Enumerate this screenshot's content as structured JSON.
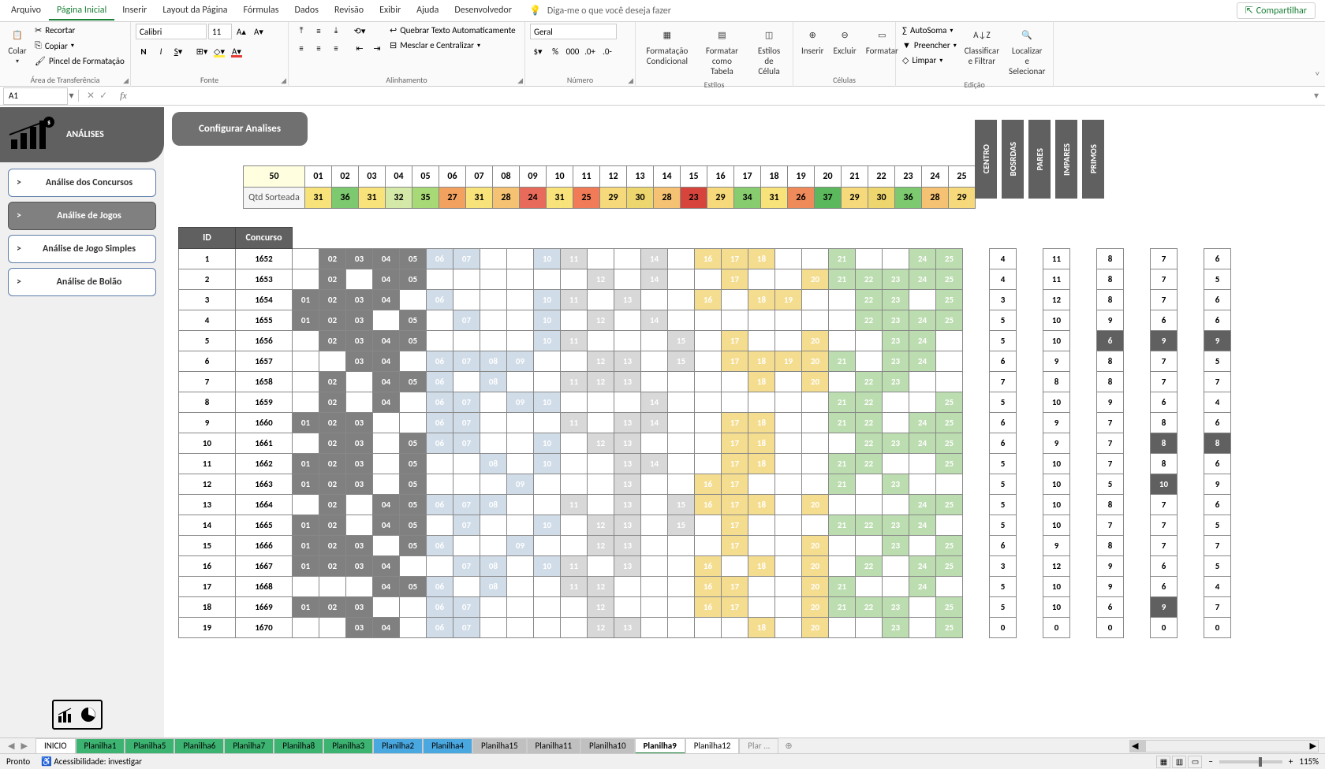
{
  "menuTabs": [
    "Arquivo",
    "Página Inicial",
    "Inserir",
    "Layout da Página",
    "Fórmulas",
    "Dados",
    "Revisão",
    "Exibir",
    "Ajuda",
    "Desenvolvedor"
  ],
  "activeTab": 1,
  "tellMe": "Diga-me o que você deseja fazer",
  "share": "Compartilhar",
  "ribbon": {
    "clipboard": {
      "paste": "Colar",
      "cut": "Recortar",
      "copy": "Copiar",
      "painter": "Pincel de Formatação",
      "label": "Área de Transferência"
    },
    "font": {
      "name": "Calibri",
      "size": "11",
      "label": "Fonte"
    },
    "align": {
      "wrap": "Quebrar Texto Automaticamente",
      "merge": "Mesclar e Centralizar",
      "label": "Alinhamento"
    },
    "number": {
      "format": "Geral",
      "label": "Número"
    },
    "styles": {
      "cond": "Formatação Condicional",
      "table": "Formatar como Tabela",
      "cell": "Estilos de Célula",
      "label": "Estilos"
    },
    "cells": {
      "insert": "Inserir",
      "delete": "Excluir",
      "format": "Formatar",
      "label": "Células"
    },
    "editing": {
      "sum": "AutoSoma",
      "fill": "Preencher",
      "clear": "Limpar",
      "sort": "Classificar e Filtrar",
      "find": "Localizar e Selecionar",
      "label": "Edição"
    }
  },
  "cellRef": "A1",
  "panel": {
    "title": "ANÁLISES",
    "btns": [
      "Análise dos Concursos",
      "Análise de Jogos",
      "Análise de Jogo Simples",
      "Análise de Bolão"
    ],
    "selected": 1,
    "config": "Configurar Analises"
  },
  "headerValue": "50",
  "qtdLabel": "Qtd Sorteada",
  "headerNums": [
    "01",
    "02",
    "03",
    "04",
    "05",
    "06",
    "07",
    "08",
    "09",
    "10",
    "11",
    "12",
    "13",
    "14",
    "15",
    "16",
    "17",
    "18",
    "19",
    "20",
    "21",
    "22",
    "23",
    "24",
    "25"
  ],
  "headerQtd": [
    "31",
    "36",
    "31",
    "32",
    "35",
    "27",
    "31",
    "28",
    "24",
    "31",
    "25",
    "29",
    "30",
    "28",
    "23",
    "29",
    "34",
    "31",
    "26",
    "37",
    "29",
    "30",
    "36",
    "28",
    "29"
  ],
  "qtdColors": [
    "#f8e27a",
    "#7cc96f",
    "#f8e27a",
    "#d4e8a8",
    "#a8d977",
    "#f2a15f",
    "#f8e27a",
    "#f5c173",
    "#e86a5a",
    "#f8e27a",
    "#f07b56",
    "#f5d97a",
    "#eed66f",
    "#f5c173",
    "#d6443c",
    "#f5d97a",
    "#88cc70",
    "#f8e27a",
    "#ef8a5a",
    "#5cb85c",
    "#f5d97a",
    "#eed66f",
    "#7cc96f",
    "#f5c173",
    "#f5d97a"
  ],
  "vcols": [
    "CENTRO",
    "BOSRDAS",
    "PARES",
    "IMPARES",
    "PRIMOS"
  ],
  "cols": [
    "ID",
    "Concurso"
  ],
  "chart_data": {
    "type": "table",
    "columns": [
      "ID",
      "Concurso",
      "01",
      "02",
      "03",
      "04",
      "05",
      "06",
      "07",
      "08",
      "09",
      "10",
      "11",
      "12",
      "13",
      "14",
      "15",
      "16",
      "17",
      "18",
      "19",
      "20",
      "21",
      "22",
      "23",
      "24",
      "25",
      "CENTRO",
      "BOSRDAS",
      "PARES",
      "IMPARES",
      "PRIMOS"
    ],
    "rows": [
      {
        "id": 1,
        "concurso": 1652,
        "nums": [
          "02",
          "03",
          "04",
          "05",
          "06",
          "07",
          "10",
          "11",
          "14",
          "16",
          "17",
          "18",
          "21",
          "24",
          "25"
        ],
        "stats": [
          4,
          11,
          8,
          7,
          6
        ]
      },
      {
        "id": 2,
        "concurso": 1653,
        "nums": [
          "02",
          "04",
          "05",
          "12",
          "14",
          "17",
          "20",
          "21",
          "22",
          "23",
          "24",
          "25"
        ],
        "stats": [
          4,
          11,
          8,
          7,
          5
        ]
      },
      {
        "id": 3,
        "concurso": 1654,
        "nums": [
          "01",
          "02",
          "03",
          "04",
          "06",
          "10",
          "11",
          "13",
          "16",
          "18",
          "19",
          "22",
          "23",
          "25"
        ],
        "stats": [
          3,
          12,
          8,
          7,
          6
        ]
      },
      {
        "id": 4,
        "concurso": 1655,
        "nums": [
          "01",
          "02",
          "03",
          "05",
          "07",
          "10",
          "12",
          "14",
          "22",
          "23",
          "24",
          "25"
        ],
        "stats": [
          5,
          10,
          9,
          6,
          6
        ]
      },
      {
        "id": 5,
        "concurso": 1656,
        "nums": [
          "02",
          "03",
          "04",
          "05",
          "10",
          "11",
          "15",
          "17",
          "20",
          "23",
          "24"
        ],
        "stats": [
          5,
          10,
          6,
          9,
          9
        ]
      },
      {
        "id": 6,
        "concurso": 1657,
        "nums": [
          "03",
          "04",
          "06",
          "07",
          "08",
          "09",
          "12",
          "13",
          "15",
          "17",
          "18",
          "19",
          "20",
          "21",
          "23",
          "24"
        ],
        "stats": [
          6,
          9,
          8,
          7,
          5
        ]
      },
      {
        "id": 7,
        "concurso": 1658,
        "nums": [
          "02",
          "04",
          "05",
          "06",
          "08",
          "11",
          "12",
          "13",
          "18",
          "20",
          "22",
          "23"
        ],
        "stats": [
          7,
          8,
          8,
          7,
          7
        ]
      },
      {
        "id": 8,
        "concurso": 1659,
        "nums": [
          "02",
          "04",
          "06",
          "07",
          "09",
          "10",
          "14",
          "21",
          "22",
          "25"
        ],
        "stats": [
          5,
          10,
          9,
          6,
          4
        ]
      },
      {
        "id": 9,
        "concurso": 1660,
        "nums": [
          "01",
          "02",
          "03",
          "06",
          "07",
          "11",
          "13",
          "14",
          "17",
          "18",
          "21",
          "22",
          "24",
          "25"
        ],
        "stats": [
          6,
          9,
          7,
          8,
          6
        ]
      },
      {
        "id": 10,
        "concurso": 1661,
        "nums": [
          "02",
          "03",
          "05",
          "06",
          "07",
          "10",
          "12",
          "13",
          "17",
          "18",
          "22",
          "23",
          "24",
          "25"
        ],
        "stats": [
          6,
          9,
          7,
          8,
          8
        ]
      },
      {
        "id": 11,
        "concurso": 1662,
        "nums": [
          "01",
          "02",
          "03",
          "05",
          "08",
          "10",
          "13",
          "14",
          "17",
          "18",
          "21",
          "22",
          "25"
        ],
        "stats": [
          5,
          10,
          7,
          8,
          6
        ]
      },
      {
        "id": 12,
        "concurso": 1663,
        "nums": [
          "01",
          "02",
          "03",
          "05",
          "09",
          "13",
          "16",
          "17",
          "21",
          "23"
        ],
        "stats": [
          5,
          10,
          5,
          10,
          9
        ]
      },
      {
        "id": 13,
        "concurso": 1664,
        "nums": [
          "02",
          "04",
          "05",
          "06",
          "07",
          "08",
          "11",
          "13",
          "15",
          "16",
          "17",
          "18",
          "20",
          "24",
          "25"
        ],
        "stats": [
          5,
          10,
          8,
          7,
          6
        ]
      },
      {
        "id": 14,
        "concurso": 1665,
        "nums": [
          "01",
          "02",
          "04",
          "05",
          "07",
          "10",
          "12",
          "13",
          "15",
          "17",
          "21",
          "22",
          "23",
          "24"
        ],
        "stats": [
          5,
          10,
          7,
          7,
          5
        ]
      },
      {
        "id": 15,
        "concurso": 1666,
        "nums": [
          "01",
          "02",
          "03",
          "05",
          "06",
          "09",
          "12",
          "13",
          "17",
          "20",
          "23",
          "25"
        ],
        "stats": [
          6,
          9,
          8,
          7,
          7
        ]
      },
      {
        "id": 16,
        "concurso": 1667,
        "nums": [
          "01",
          "02",
          "03",
          "04",
          "07",
          "08",
          "10",
          "11",
          "13",
          "16",
          "18",
          "20",
          "22",
          "24",
          "25"
        ],
        "stats": [
          3,
          12,
          9,
          6,
          5
        ]
      },
      {
        "id": 17,
        "concurso": 1668,
        "nums": [
          "04",
          "05",
          "06",
          "08",
          "11",
          "12",
          "16",
          "17",
          "20",
          "21",
          "24"
        ],
        "stats": [
          5,
          10,
          9,
          6,
          4
        ]
      },
      {
        "id": 18,
        "concurso": 1669,
        "nums": [
          "01",
          "02",
          "03",
          "06",
          "07",
          "12",
          "16",
          "17",
          "20",
          "21",
          "22",
          "23",
          "25"
        ],
        "stats": [
          5,
          10,
          6,
          9,
          7
        ]
      },
      {
        "id": 19,
        "concurso": 1670,
        "nums": [
          "03",
          "04",
          "06",
          "07",
          "12",
          "13",
          "18",
          "20",
          "23",
          "25"
        ],
        "stats": [
          0,
          0,
          0,
          0,
          0
        ]
      }
    ]
  },
  "sheetTabs": [
    {
      "name": "INICIO",
      "cls": "w"
    },
    {
      "name": "Planilha1",
      "cls": "g"
    },
    {
      "name": "Planilha5",
      "cls": "g"
    },
    {
      "name": "Planilha6",
      "cls": "g"
    },
    {
      "name": "Planilha7",
      "cls": "g"
    },
    {
      "name": "Planilha8",
      "cls": "g"
    },
    {
      "name": "Planilha3",
      "cls": "g"
    },
    {
      "name": "Planilha2",
      "cls": "b"
    },
    {
      "name": "Planilha4",
      "cls": "b"
    },
    {
      "name": "Planilha15",
      "cls": "gr"
    },
    {
      "name": "Planilha11",
      "cls": "gr"
    },
    {
      "name": "Planilha10",
      "cls": "gr"
    },
    {
      "name": "Planilha9",
      "cls": "act"
    },
    {
      "name": "Planilha12",
      "cls": "w"
    },
    {
      "name": "Plar ...",
      "cls": "pl"
    }
  ],
  "status": {
    "ready": "Pronto",
    "access": "Acessibilidade: investigar",
    "zoom": "115%"
  }
}
